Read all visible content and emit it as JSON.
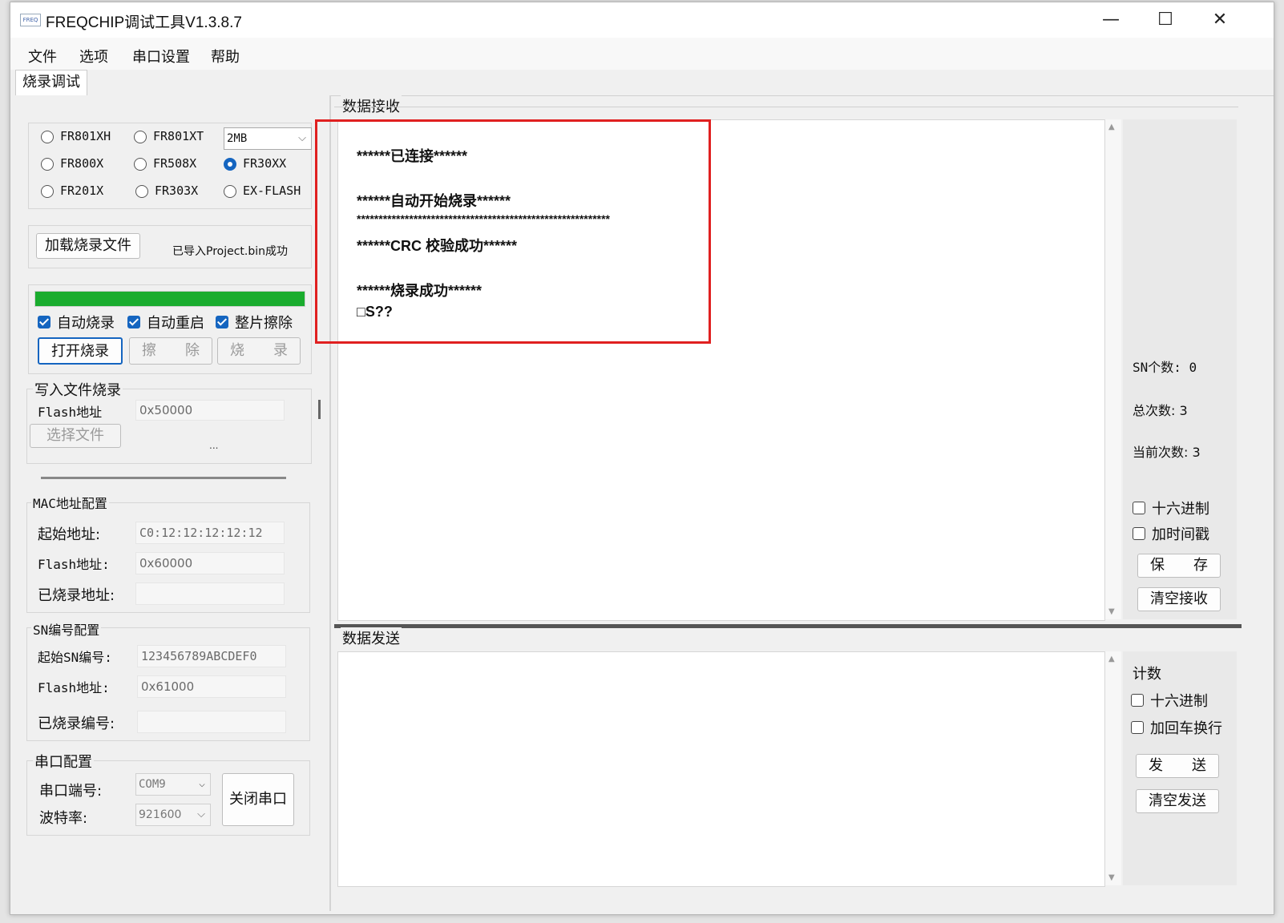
{
  "window": {
    "title": "FREQCHIP调试工具V1.3.8.7",
    "app_icon_text": "FREQ"
  },
  "controls": {
    "minimize": "—",
    "maximize": "☐",
    "close": "✕"
  },
  "menu": [
    "文件",
    "选项",
    "串口设置",
    "帮助"
  ],
  "tab": "烧录调试",
  "chips": {
    "options": [
      "FR801XH",
      "FR801XT",
      "FR800X",
      "FR508X",
      "FR30XX",
      "FR201X",
      "FR303X",
      "EX-FLASH"
    ],
    "selected": "FR30XX",
    "size_select": "2MB"
  },
  "load": {
    "button": "加载烧录文件",
    "status": "已导入Project.bin成功"
  },
  "progress": {
    "value": 1.0,
    "color": "#1aac2e"
  },
  "burn_options": {
    "auto_burn": "自动烧录",
    "auto_restart": "自动重启",
    "full_erase": "整片擦除",
    "open_burn": "打开烧录",
    "erase": "擦　　除",
    "burn": "烧　　录"
  },
  "write_file": {
    "title": "写入文件烧录",
    "flash_label": "Flash地址",
    "flash_value": "0x50000",
    "select_file": "选择文件",
    "ellipsis": "..."
  },
  "mac": {
    "title": "MAC地址配置",
    "start_label": "起始地址:",
    "start_value": "C0:12:12:12:12:12",
    "flash_label": "Flash地址:",
    "flash_value": "0x60000",
    "burned_label": "已烧录地址:",
    "burned_value": ""
  },
  "sn": {
    "title": "SN编号配置",
    "start_label": "起始SN编号:",
    "start_value": "123456789ABCDEF0",
    "flash_label": "Flash地址:",
    "flash_value": "0x61000",
    "burned_label": "已烧录编号:",
    "burned_value": ""
  },
  "serial": {
    "title": "串口配置",
    "port_label": "串口端号:",
    "port_value": "COM9",
    "baud_label": "波特率:",
    "baud_value": "921600",
    "close_button": "关闭串口"
  },
  "receive": {
    "title": "数据接收",
    "lines": [
      "******已连接******",
      "******自动开始烧录******",
      "**********************************************************",
      "******CRC 校验成功******",
      "******烧录成功******",
      "□S??"
    ],
    "sn_count": "SN个数: 0",
    "total_count": "总次数: 3",
    "current_count": "当前次数: 3",
    "hex": "十六进制",
    "timestamp": "加时间戳",
    "save": "保　　存",
    "clear": "清空接收",
    "highlight_color": "#e02020"
  },
  "send": {
    "title": "数据发送",
    "count": "计数",
    "hex": "十六进制",
    "crlf": "加回车换行",
    "send_button": "发　　送",
    "clear": "清空发送"
  }
}
